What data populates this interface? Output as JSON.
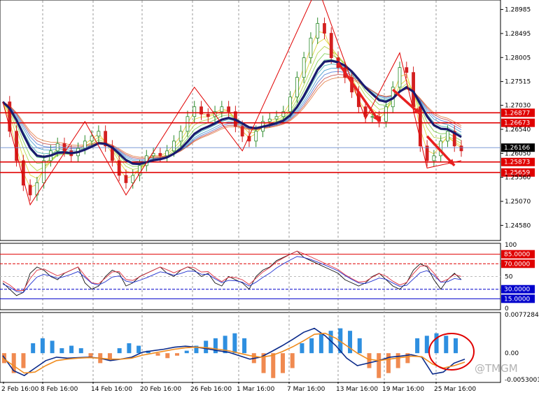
{
  "chart_data": {
    "type": "line",
    "symbol_window": "price panel with indicators",
    "price_axis": [
      "1.28985",
      "1.28495",
      "1.28005",
      "1.27515",
      "1.27030",
      "1.26540",
      "1.26050",
      "1.25560",
      "1.25070",
      "1.24580"
    ],
    "price_range": [
      1.243,
      1.2915
    ],
    "price_levels": [
      {
        "label": "1.26877",
        "value": 1.26877,
        "color": "#e00000"
      },
      {
        "label": "1.26673",
        "value": 1.26673,
        "color": "#e00000"
      },
      {
        "label": "1.26166",
        "value": 1.26166,
        "color": "#000000"
      },
      {
        "label": "1.25873",
        "value": 1.25873,
        "color": "#e00000"
      },
      {
        "label": "1.25659",
        "value": 1.25659,
        "color": "#e00000"
      }
    ],
    "x_labels": [
      "2 Feb 16:00",
      "8 Feb 16:00",
      "14 Feb 16:00",
      "20 Feb 16:00",
      "26 Feb 16:00",
      "1 Mar 16:00",
      "7 Mar 16:00",
      "13 Mar 16:00",
      "19 Mar 16:00",
      "25 Mar 16:00"
    ],
    "close_prices": [
      1.271,
      1.265,
      1.259,
      1.254,
      1.252,
      1.2545,
      1.259,
      1.261,
      1.2625,
      1.261,
      1.26,
      1.2615,
      1.263,
      1.264,
      1.265,
      1.262,
      1.259,
      1.256,
      1.2545,
      1.256,
      1.258,
      1.26,
      1.2605,
      1.26,
      1.261,
      1.263,
      1.265,
      1.268,
      1.27,
      1.2685,
      1.268,
      1.269,
      1.27,
      1.269,
      1.266,
      1.264,
      1.263,
      1.265,
      1.267,
      1.2675,
      1.268,
      1.269,
      1.272,
      1.276,
      1.28,
      1.284,
      1.287,
      1.285,
      1.28,
      1.278,
      1.276,
      1.273,
      1.27,
      1.268,
      1.268,
      1.267,
      1.27,
      1.274,
      1.278,
      1.277,
      1.27,
      1.262,
      1.259,
      1.26,
      1.263,
      1.265,
      1.262,
      1.261
    ],
    "osc1_axis": [
      "100",
      "85.0000",
      "70.0000",
      "50",
      "30.0000",
      "15.0000",
      "0"
    ],
    "osc1_levels": [
      {
        "label": "85.0000",
        "value": 85,
        "color": "#e00000"
      },
      {
        "label": "70.0000",
        "value": 70,
        "color": "#e00000"
      },
      {
        "label": "30.0000",
        "value": 30,
        "color": "#0000cc"
      },
      {
        "label": "15.0000",
        "value": 15,
        "color": "#0000cc"
      }
    ],
    "osc1_values": [
      40,
      30,
      20,
      25,
      55,
      65,
      60,
      50,
      45,
      55,
      60,
      65,
      40,
      30,
      35,
      50,
      60,
      55,
      35,
      40,
      50,
      55,
      60,
      65,
      55,
      50,
      60,
      65,
      60,
      50,
      55,
      40,
      35,
      50,
      45,
      40,
      30,
      50,
      60,
      65,
      75,
      80,
      85,
      90,
      80,
      75,
      70,
      65,
      60,
      55,
      45,
      40,
      35,
      40,
      50,
      55,
      45,
      35,
      30,
      40,
      60,
      70,
      65,
      45,
      30,
      45,
      55,
      45
    ],
    "osc2_axis": [
      "0.0077284",
      "0.00",
      "-0.0053001"
    ],
    "osc2_range": [
      -0.0056,
      0.0079
    ],
    "osc2_histogram": [
      -0.002,
      -0.004,
      -0.003,
      0.002,
      0.003,
      0.0025,
      0.001,
      0.0015,
      0.001,
      -0.001,
      -0.002,
      -0.0015,
      0.001,
      0.002,
      0.0015,
      0.0005,
      -0.0005,
      -0.001,
      -0.0005,
      0.0005,
      0.0015,
      0.0025,
      0.003,
      0.0035,
      0.004,
      0.003,
      -0.002,
      -0.004,
      -0.005,
      -0.004,
      -0.003,
      0.002,
      0.003,
      0.004,
      0.0045,
      0.005,
      0.0045,
      0.003,
      -0.003,
      -0.005,
      -0.004,
      -0.003,
      -0.002,
      0.003,
      0.0035,
      0.004,
      0.0035,
      0.003
    ],
    "osc2_line_main": [
      -0.0005,
      -0.0035,
      -0.0045,
      -0.003,
      -0.0015,
      -0.0008,
      -0.001,
      -0.0009,
      -0.0008,
      -0.001,
      -0.0015,
      -0.0012,
      -0.0008,
      0.0002,
      0.0005,
      0.0008,
      0.0012,
      0.0014,
      0.0012,
      0.0009,
      0.0005,
      0.0002,
      -0.0005,
      -0.0012,
      -0.0008,
      0.0003,
      0.0015,
      0.0028,
      0.0042,
      0.005,
      0.0035,
      0.0015,
      -0.001,
      -0.0025,
      -0.002,
      -0.0015,
      -0.0008,
      -0.0006,
      -0.0003,
      -0.0008,
      -0.0042,
      -0.0038,
      -0.002,
      -0.0012
    ],
    "osc2_line_signal": [
      -0.001,
      -0.0025,
      -0.004,
      -0.0038,
      -0.0025,
      -0.0015,
      -0.0012,
      -0.001,
      -0.0009,
      -0.001,
      -0.0012,
      -0.0012,
      -0.001,
      -0.0004,
      0.0,
      0.0004,
      0.0008,
      0.0011,
      0.0012,
      0.0011,
      0.0008,
      0.0005,
      0.0,
      -0.0005,
      -0.0008,
      -0.0005,
      0.0003,
      0.0013,
      0.0025,
      0.0038,
      0.004,
      0.003,
      0.0015,
      0.0,
      -0.0012,
      -0.0015,
      -0.0012,
      -0.0009,
      -0.0006,
      -0.0007,
      -0.0022,
      -0.003,
      -0.0025,
      -0.0018
    ],
    "colors": {
      "bull": "#2a8a2a",
      "bear": "#d42020",
      "ma_thick": "#1a1a6e",
      "hist_pos": "#2e8fe0",
      "hist_neg": "#f08a50",
      "macd": "#0a2a8a",
      "signal": "#f08c1e"
    }
  },
  "watermark": "@TMGM"
}
